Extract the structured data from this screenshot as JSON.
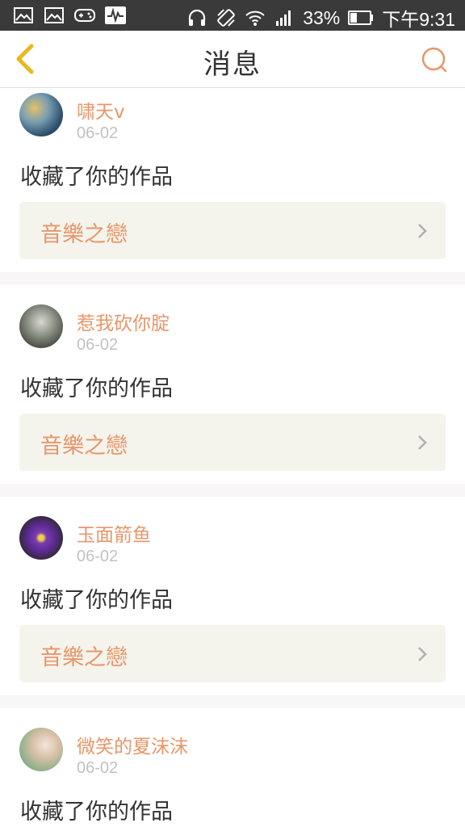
{
  "status_bar": {
    "battery_text": "33%",
    "time": "下午9:31",
    "icons": [
      "image-icon",
      "image-icon",
      "gamepad-icon",
      "activity-icon",
      "headphones-icon",
      "vibrate-icon",
      "wifi-icon",
      "signal-icon",
      "battery-icon"
    ]
  },
  "header": {
    "title": "消息",
    "back_icon": "chevron-left-icon",
    "search_icon": "search-icon",
    "accent_color": "#e8966a",
    "back_color": "#e8b820"
  },
  "messages": [
    {
      "username": "啸天v",
      "date": "06-02",
      "action": "收藏了你的作品",
      "work_title": "音樂之戀"
    },
    {
      "username": "惹我砍你腚",
      "date": "06-02",
      "action": "收藏了你的作品",
      "work_title": "音樂之戀"
    },
    {
      "username": "玉面箭鱼",
      "date": "06-02",
      "action": "收藏了你的作品",
      "work_title": "音樂之戀"
    },
    {
      "username": "微笑的夏沫沫",
      "date": "06-02",
      "action": "收藏了你的作品",
      "work_title": ""
    }
  ]
}
